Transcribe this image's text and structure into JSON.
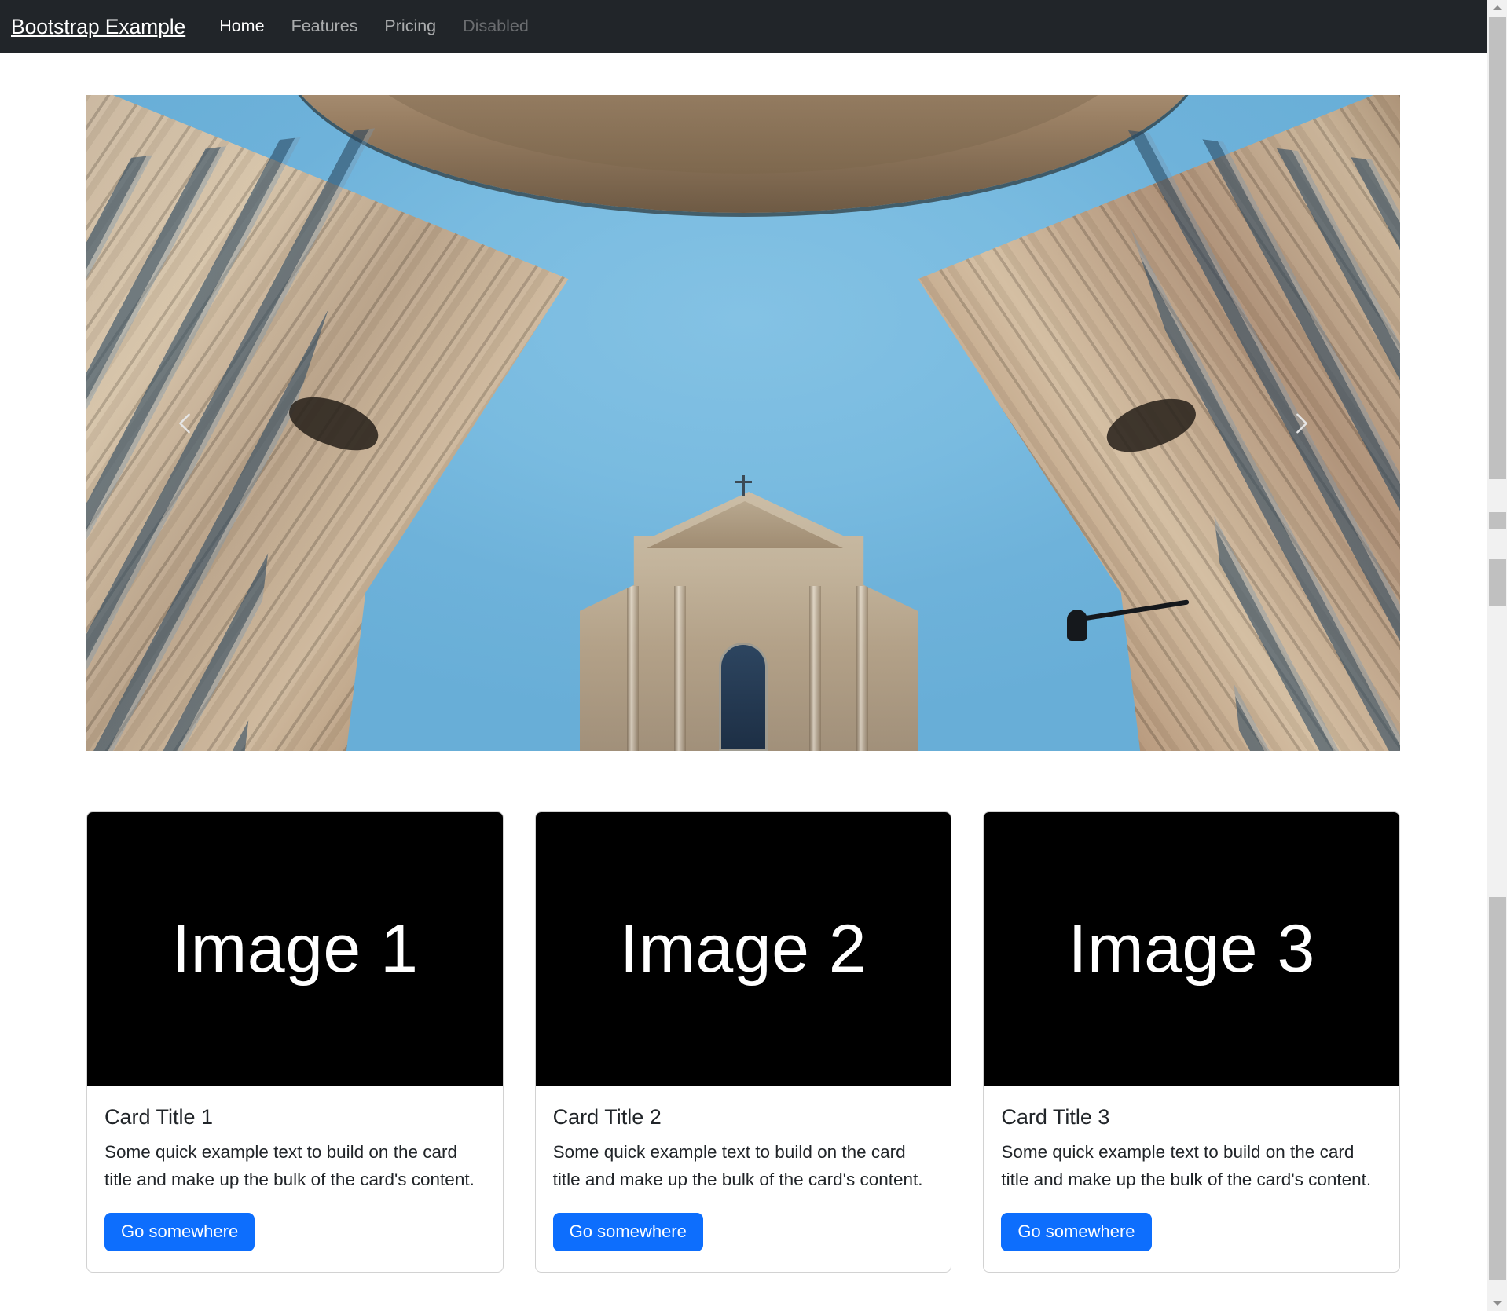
{
  "navbar": {
    "brand": "Bootstrap Example",
    "links": [
      {
        "label": "Home",
        "state": "active"
      },
      {
        "label": "Features",
        "state": "inactive"
      },
      {
        "label": "Pricing",
        "state": "inactive"
      },
      {
        "label": "Disabled",
        "state": "disabled"
      }
    ],
    "background_color": "#212529"
  },
  "carousel": {
    "prev_icon": "chevron-left-icon",
    "next_icon": "chevron-right-icon",
    "slide_alt": "Looking up between two ornate Roman buildings at a blue sky with a baroque church facade",
    "sky_color": "#6cb4de",
    "building_color": "#bda488"
  },
  "cards": [
    {
      "image_label": "Image 1",
      "title": "Card Title 1",
      "text": "Some quick example text to build on the card title and make up the bulk of the card's content.",
      "button_label": "Go somewhere"
    },
    {
      "image_label": "Image 2",
      "title": "Card Title 2",
      "text": "Some quick example text to build on the card title and make up the bulk of the card's content.",
      "button_label": "Go somewhere"
    },
    {
      "image_label": "Image 3",
      "title": "Card Title 3",
      "text": "Some quick example text to build on the card title and make up the bulk of the card's content.",
      "button_label": "Go somewhere"
    }
  ],
  "theme": {
    "primary_button_color": "#0d6efd",
    "card_image_background": "#000000",
    "page_background": "#ffffff",
    "card_border_color": "rgba(0,0,0,0.175)"
  },
  "scrollbar": {
    "up_arrow_icon": "caret-up-icon",
    "down_arrow_icon": "caret-down-icon",
    "track_color": "#f1f1f1",
    "thumb_color": "#c0c0c0"
  }
}
